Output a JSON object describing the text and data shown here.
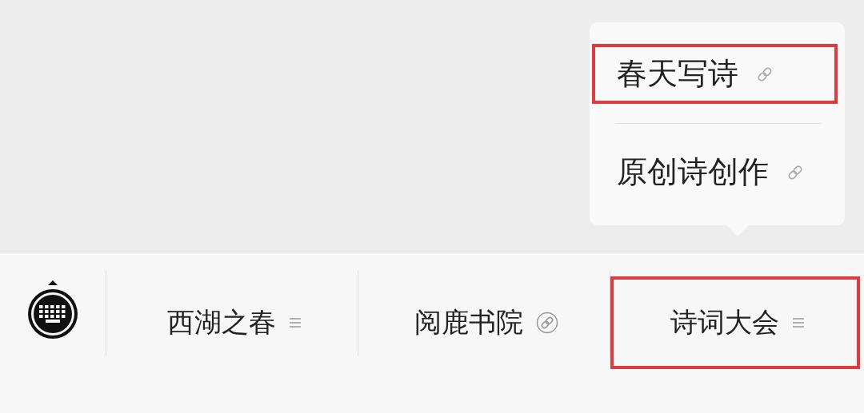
{
  "menu": [
    {
      "label": "西湖之春",
      "kind": "submenu",
      "highlighted": false
    },
    {
      "label": "阅鹿书院",
      "kind": "link",
      "highlighted": false
    },
    {
      "label": "诗词大会",
      "kind": "submenu",
      "highlighted": true,
      "children": [
        {
          "label": "春天写诗",
          "kind": "link",
          "highlighted": true
        },
        {
          "label": "原创诗创作",
          "kind": "link",
          "highlighted": false
        }
      ]
    }
  ]
}
